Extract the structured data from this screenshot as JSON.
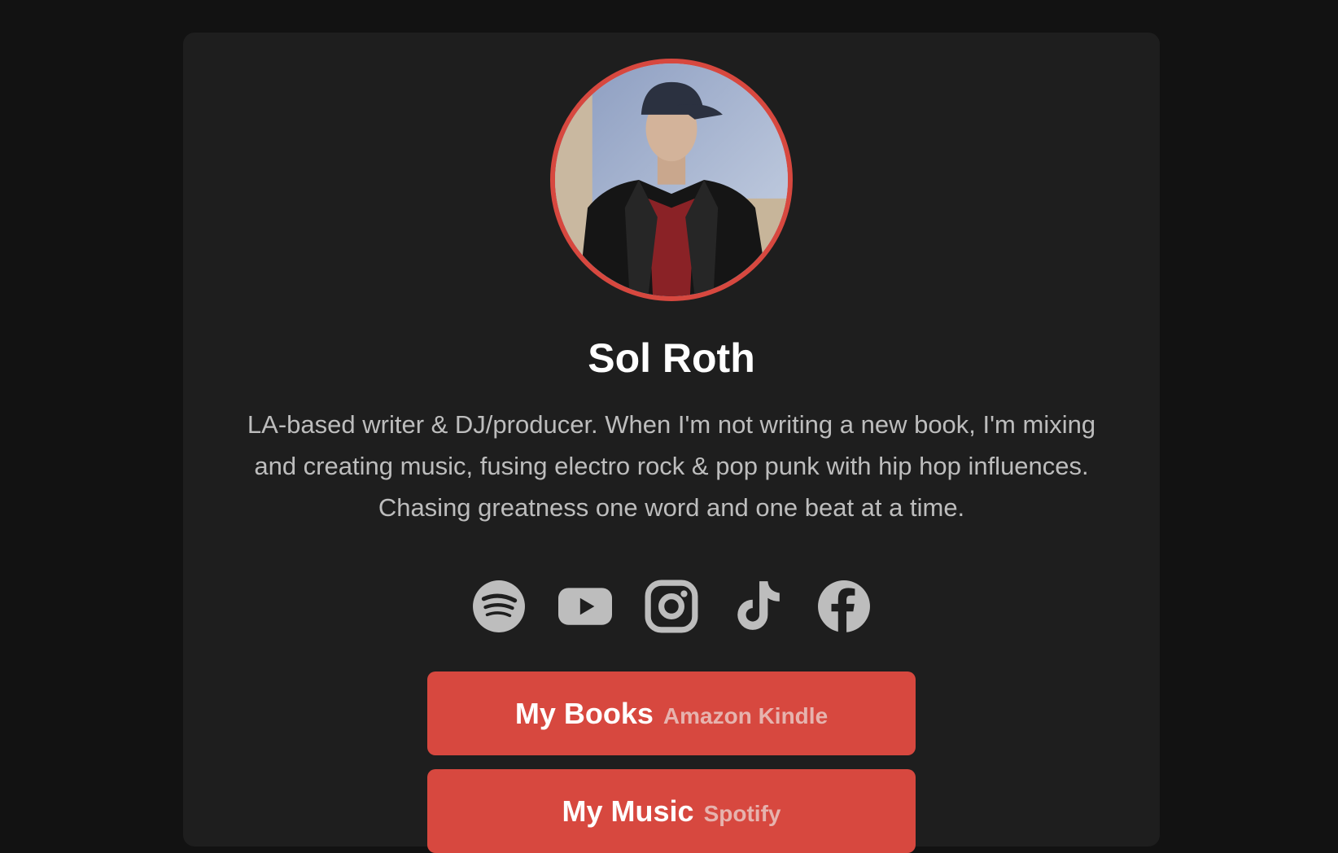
{
  "profile": {
    "name": "Sol Roth",
    "bio": "LA-based writer & DJ/producer. When I'm not writing a new book, I'm mixing and creating music, fusing electro rock & pop punk with hip hop influences. Chasing greatness one word and one beat at a time."
  },
  "socials": [
    {
      "icon": "spotify-icon"
    },
    {
      "icon": "youtube-icon"
    },
    {
      "icon": "instagram-icon"
    },
    {
      "icon": "tiktok-icon"
    },
    {
      "icon": "facebook-icon"
    }
  ],
  "links": [
    {
      "label": "My Books",
      "sublabel": "Amazon Kindle"
    },
    {
      "label": "My Music",
      "sublabel": "Spotify"
    }
  ],
  "colors": {
    "page_background": "#121212",
    "card_background": "#1e1e1e",
    "accent": "#d7483f",
    "icon": "#bdbdbd",
    "bio_text": "#bdbdbd"
  }
}
